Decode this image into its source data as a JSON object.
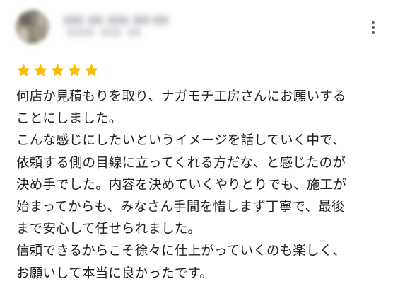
{
  "review": {
    "rating": 5,
    "rating_max": 5,
    "star_color": "#fbbc04",
    "lines": [
      "何店か見積もりを取り、ナガモチ工房さんにお願いする",
      "ことにしました。",
      "こんな感じにしたいというイメージを話していく中で、",
      "依頼する側の目線に立ってくれる方だな、と感じたのが",
      "決め手でした。内容を決めていくやりとりでも、施工が",
      "始まってからも、みなさん手間を惜しまず丁寧で、最後",
      "まで安心して任せられました。",
      "信頼できるからこそ徐々に仕上がっていくのも楽しく、",
      "お願いして本当に良かったです。"
    ]
  },
  "icons": {
    "menu": "more-vert-icon",
    "star": "star-icon"
  }
}
